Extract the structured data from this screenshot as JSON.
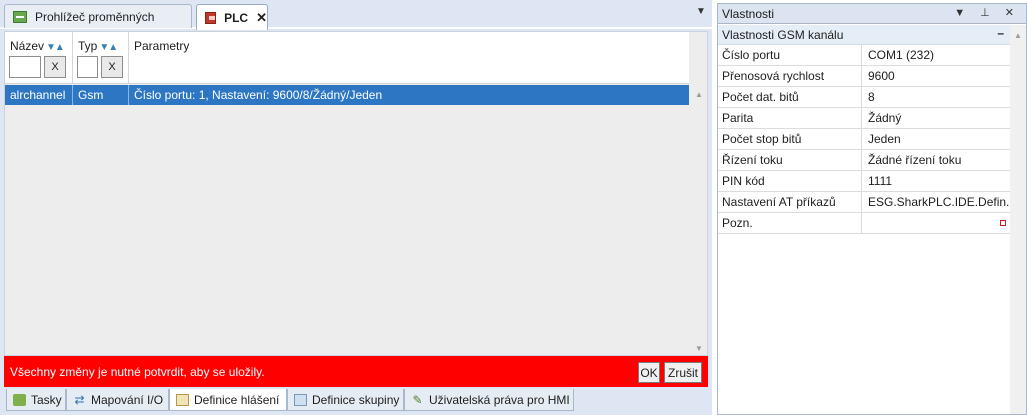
{
  "doc_tabs": [
    {
      "label": "Prohlížeč proměnných",
      "icon": "grid-icon"
    },
    {
      "label": "PLC",
      "icon": "plc-icon",
      "active": true
    }
  ],
  "tab_close": "✕",
  "tab_menu": "▼",
  "grid": {
    "columns": [
      {
        "label": "Název",
        "filter_button": "X"
      },
      {
        "label": "Typ",
        "filter_button": "X"
      },
      {
        "label": "Parametry"
      }
    ],
    "rows": [
      {
        "name": "alrchannel",
        "type": "Gsm",
        "params": "Číslo portu: 1, Nastavení: 9600/8/Žádný/Jeden",
        "selected": true
      }
    ]
  },
  "notice": {
    "text": "Všechny změny je nutné potvrdit, aby se uložily.",
    "ok_label": "OK",
    "cancel_label": "Zrušit",
    "color": "#ff0000"
  },
  "bottom_tabs": [
    {
      "label": "Tasky",
      "icon": "tasks-icon"
    },
    {
      "label": "Mapování I/O",
      "icon": "mapping-icon"
    },
    {
      "label": "Definice hlášení",
      "icon": "mail-icon",
      "active": true
    },
    {
      "label": "Definice skupiny",
      "icon": "group-icon"
    },
    {
      "label": "Uživatelská práva pro HMI",
      "icon": "user-icon"
    }
  ],
  "properties": {
    "title": "Vlastnosti",
    "title_controls": "▼ ⊥ ✕",
    "category": "Vlastnosti GSM kanálu",
    "collapse": "–",
    "rows": [
      {
        "key": "Číslo portu",
        "value": "COM1 (232)"
      },
      {
        "key": "Přenosová rychlost",
        "value": "9600"
      },
      {
        "key": "Počet dat. bitů",
        "value": "8"
      },
      {
        "key": "Parita",
        "value": "Žádný"
      },
      {
        "key": "Počet stop bitů",
        "value": "Jeden"
      },
      {
        "key": "Řízení toku",
        "value": "Žádné řízení toku"
      },
      {
        "key": "PIN kód",
        "value": "1111"
      },
      {
        "key": "Nastavení AT příkazů",
        "value": "ESG.SharkPLC.IDE.Defin..."
      },
      {
        "key": "Pozn.",
        "value": ""
      }
    ]
  },
  "accent_color": "#2d76c4"
}
